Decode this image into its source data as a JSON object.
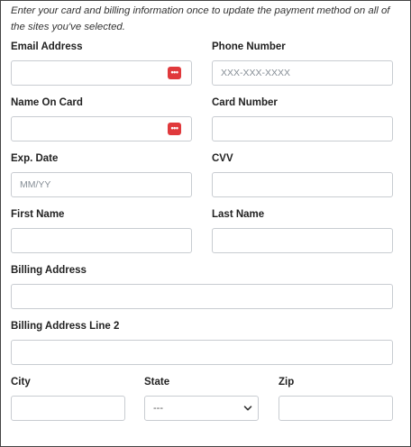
{
  "intro_text": "Enter your card and billing information once to update the payment method on all of the sites you've selected.",
  "fields": {
    "email": {
      "label": "Email Address",
      "placeholder": ""
    },
    "phone": {
      "label": "Phone Number",
      "placeholder": "XXX-XXX-XXXX"
    },
    "name_on_card": {
      "label": "Name On Card",
      "placeholder": ""
    },
    "card_number": {
      "label": "Card Number",
      "placeholder": ""
    },
    "exp_date": {
      "label": "Exp. Date",
      "placeholder": "MM/YY"
    },
    "cvv": {
      "label": "CVV",
      "placeholder": ""
    },
    "first_name": {
      "label": "First Name",
      "placeholder": ""
    },
    "last_name": {
      "label": "Last Name",
      "placeholder": ""
    },
    "billing_address": {
      "label": "Billing Address",
      "placeholder": ""
    },
    "billing_address_2": {
      "label": "Billing Address Line 2",
      "placeholder": ""
    },
    "city": {
      "label": "City",
      "placeholder": ""
    },
    "state": {
      "label": "State",
      "selected": "---"
    },
    "zip": {
      "label": "Zip",
      "placeholder": ""
    }
  },
  "password_manager_icon_glyph": "•••",
  "icons": {
    "password_manager": "password-manager-icon",
    "dropdown": "chevron-down-icon"
  },
  "colors": {
    "password_manager_icon": "#e0393c",
    "input_border": "#c8ccd1"
  }
}
